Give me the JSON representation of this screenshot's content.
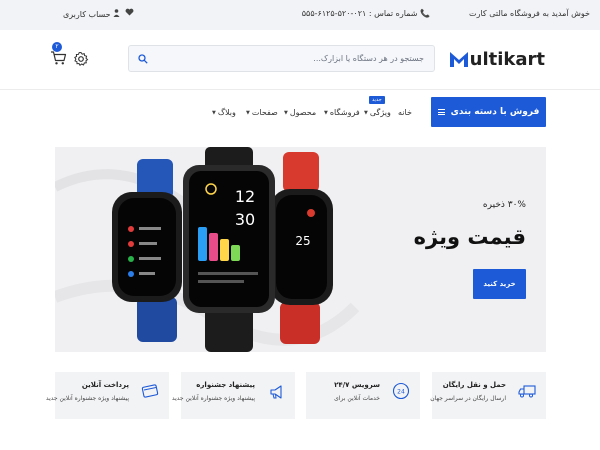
{
  "topbar": {
    "welcome": "خوش آمدید به فروشگاه مالتی کارت",
    "phone": "شماره تماس : ۰۲۱-۵۲۰-۶۱۲۵-۵۵۵",
    "account": "حساب کاربری"
  },
  "header": {
    "logo_m": "M",
    "logo_rest": "ultikart",
    "search_placeholder": "جستجو در هر دستگاه یا ابزارک...",
    "cart_count": "۲"
  },
  "nav": {
    "categories_button": "فروش با دسته بندی",
    "items": [
      "خانه",
      "ویژگی",
      "فروشگاه",
      "محصول",
      "صفحات",
      "وبلاگ"
    ],
    "new_tag": "جدید"
  },
  "hero": {
    "save_text": "۳۰% ذخیره",
    "title": "قیمت ویژه",
    "buy_button": "خرید کنید"
  },
  "features": [
    {
      "title": "حمل و نقل رایگان",
      "desc": "ارسال رایگان در سراسر جهان",
      "icon": "truck-icon"
    },
    {
      "title": "سرویس ۲۴/۷",
      "desc": "خدمات آنلاین برای",
      "icon": "support-24-icon"
    },
    {
      "title": "پیشنهاد جشنواره",
      "desc": "پیشنهاد ویژه جشنواره آنلاین جدید",
      "icon": "megaphone-icon"
    },
    {
      "title": "پرداخت آنلاین",
      "desc": "پیشنهاد ویژه جشنواره آنلاین جدید",
      "icon": "card-icon"
    }
  ],
  "colors": {
    "accent": "#1d5ad8",
    "topbar_bg": "#f1f3f6",
    "hero_bg": "#f0f0f2",
    "feature_bg": "#f2f3f5"
  }
}
